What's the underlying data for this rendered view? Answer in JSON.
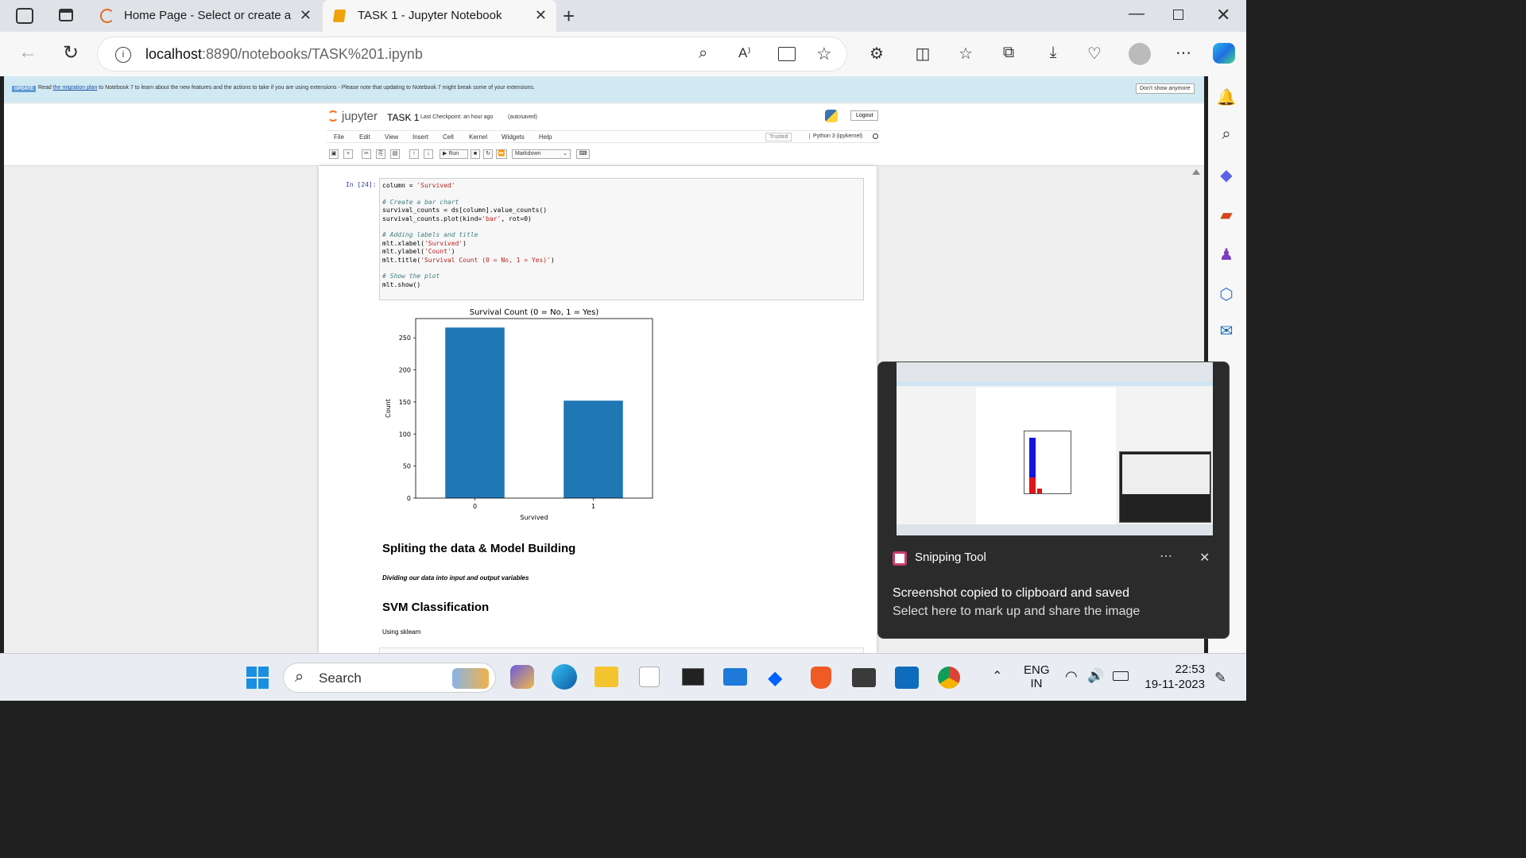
{
  "browser": {
    "tabs": [
      {
        "title": "Home Page - Select or create a n",
        "active": false
      },
      {
        "title": "TASK 1 - Jupyter Notebook",
        "active": true
      }
    ],
    "url_host": "localhost",
    "url_rest": ":8890/notebooks/TASK%201.ipynb"
  },
  "banner": {
    "badge": "UPDATE",
    "text_before": "Read ",
    "link": "the migration plan",
    "text_after": " to Notebook 7 to learn about the new features and the actions to take if you are using extensions - Please note that updating to Notebook 7 might break some of your extensions.",
    "dismiss": "Don't show anymore"
  },
  "jupyter": {
    "logo": "jupyter",
    "notebook_name": "TASK 1",
    "checkpoint": "Last Checkpoint: an hour ago",
    "autosave": "(autosaved)",
    "logout": "Logout",
    "menus": [
      "File",
      "Edit",
      "View",
      "Insert",
      "Cell",
      "Kernel",
      "Widgets",
      "Help"
    ],
    "trusted": "Trusted",
    "kernel": "Python 3 (ipykernel)",
    "run_label": "Run",
    "cell_type": "Markdown"
  },
  "cell": {
    "prompt": "In [24]:",
    "code_lines": [
      {
        "t": "column = ",
        "s": "'Survived'"
      },
      {
        "t": ""
      },
      {
        "c": "# Create a bar chart"
      },
      {
        "t": "survival_counts = ds[column].value_counts()"
      },
      {
        "t": "survival_counts.plot(kind=",
        "s": "'bar'",
        "t2": ", rot=0)"
      },
      {
        "t": ""
      },
      {
        "c": "# Adding labels and title"
      },
      {
        "t": "mlt.xlabel(",
        "s": "'Survived'",
        "t2": ")"
      },
      {
        "t": "mlt.ylabel(",
        "s": "'Count'",
        "t2": ")"
      },
      {
        "t": "mlt.title(",
        "s": "'Survival Count (0 = No, 1 = Yes)'",
        "t2": ")"
      },
      {
        "t": ""
      },
      {
        "c": "# Show the plot"
      },
      {
        "t": "mlt.show()"
      }
    ]
  },
  "chart_data": {
    "type": "bar",
    "title": "Survival Count (0 = No, 1 = Yes)",
    "xlabel": "Survived",
    "ylabel": "Count",
    "categories": [
      "0",
      "1"
    ],
    "values": [
      266,
      152
    ],
    "ylim": [
      0,
      280
    ],
    "yticks": [
      0,
      50,
      100,
      150,
      200,
      250
    ],
    "color": "#1f77b4",
    "grid": false
  },
  "markdown": {
    "h1": "Spliting the data & Model Building",
    "em": "Dividing our data into input and output variables",
    "h2": "SVM Classification",
    "p": "Using sklearn"
  },
  "toast": {
    "app": "Snipping Tool",
    "line1": "Screenshot copied to clipboard and saved",
    "line2": "Select here to mark up and share the image"
  },
  "taskbar": {
    "search_placeholder": "Search",
    "lang1": "ENG",
    "lang2": "IN",
    "time": "22:53",
    "date": "19-11-2023"
  },
  "colors": {
    "accent": "#1f77b4",
    "banner": "#d1e9f3",
    "taskbar": "#e9edf3"
  }
}
